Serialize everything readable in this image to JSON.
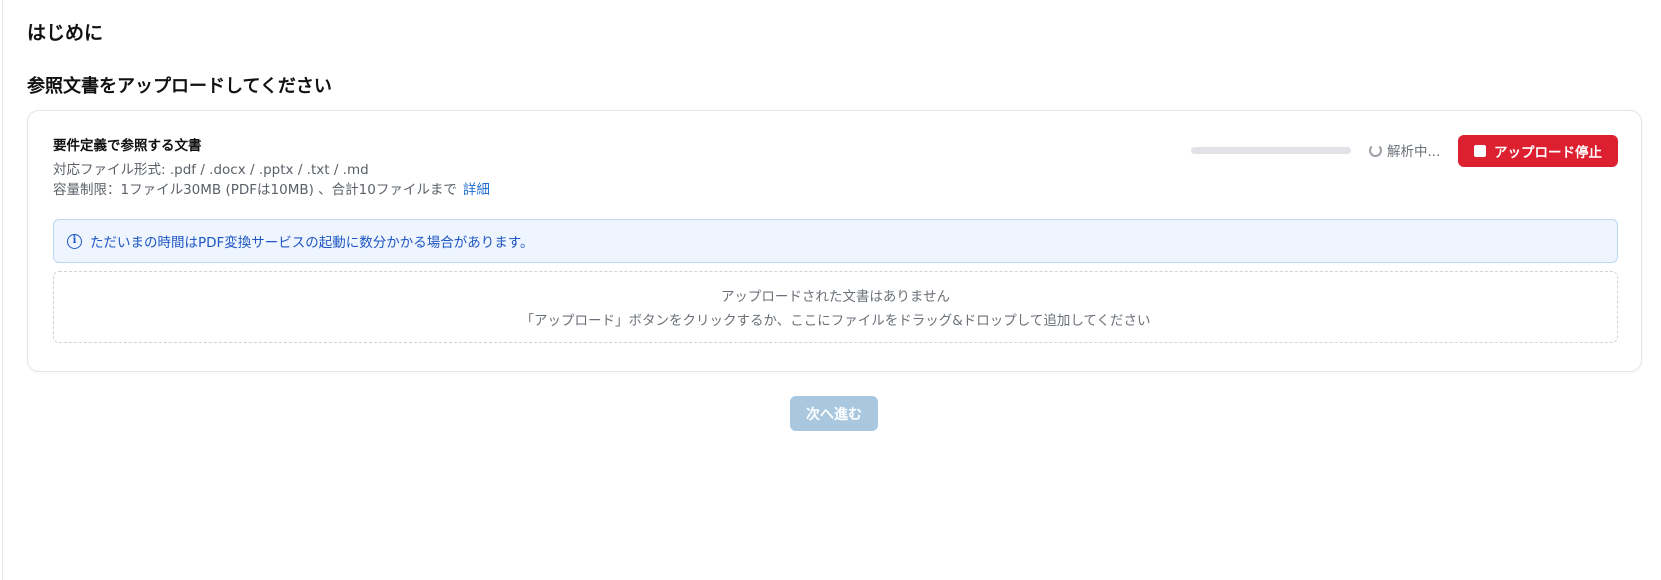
{
  "page": {
    "title": "はじめに",
    "section_title": "参照文書をアップロードしてください"
  },
  "upload_card": {
    "heading": "要件定義で参照する文書",
    "formats": "対応ファイル形式: .pdf / .docx / .pptx / .txt / .md",
    "limit": "容量制限：1ファイル30MB (PDFは10MB) 、合計10ファイルまで",
    "detail_link": "詳細",
    "progress_fraction": 0,
    "status_text": "解析中...",
    "status_icon": "spinner-icon",
    "stop_button_label": "アップロード停止",
    "stop_button_icon": "stop-icon",
    "notice_icon": "info-icon",
    "notice_text": "ただいまの時間はPDF変換サービスの起動に数分かかる場合があります。",
    "empty_title": "アップロードされた文書はありません",
    "empty_hint": "「アップロード」ボタンをクリックするか、ここにファイルをドラッグ&ドロップして追加してください"
  },
  "footer": {
    "next_button_label": "次へ進む"
  },
  "colors": {
    "accent_blue": "#1f6fd1",
    "stop_red": "#dc2030",
    "notice_bg": "#eef5fe",
    "next_disabled": "#a9c8e0"
  }
}
